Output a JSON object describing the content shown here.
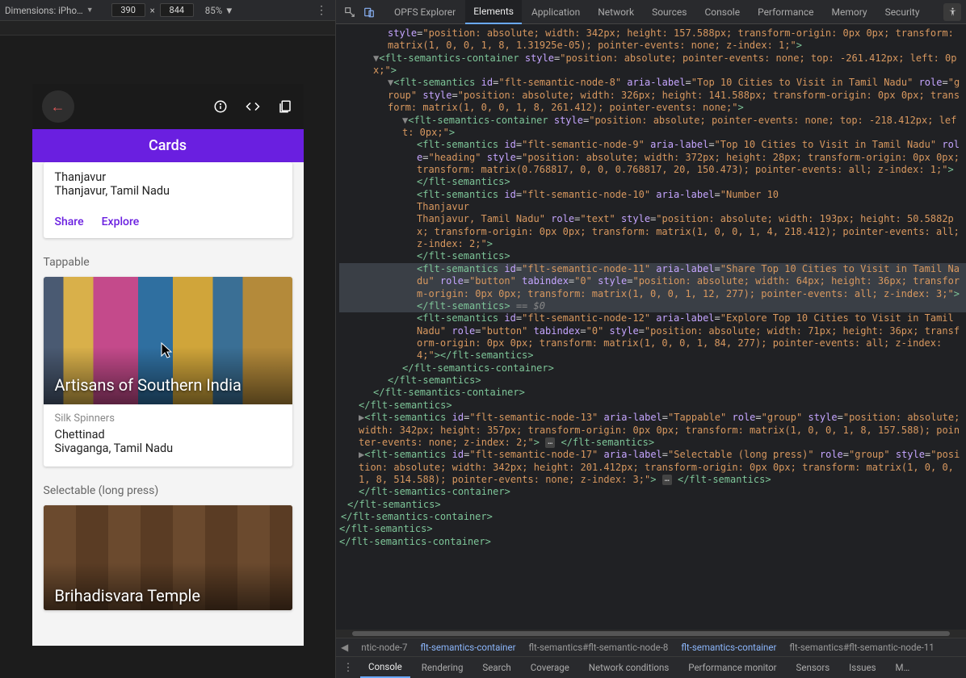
{
  "dev_toolbar": {
    "dimension_label": "Dimensions: iPho…",
    "width": "390",
    "height": "844",
    "zoom": "85%"
  },
  "phone": {
    "header": "Cards",
    "card1": {
      "title": "Thanjavur",
      "subtitle": "Thanjavur, Tamil Nadu",
      "action_share": "Share",
      "action_explore": "Explore"
    },
    "section_tappable": "Tappable",
    "card2": {
      "overlay": "Artisans of Southern India",
      "sub": "Silk Spinners",
      "title": "Chettinad",
      "subtitle": "Sivaganga, Tamil Nadu"
    },
    "section_selectable": "Selectable (long press)",
    "card3": {
      "overlay": "Brihadisvara Temple"
    }
  },
  "devtools_tabs": {
    "opfs": "OPFS Explorer",
    "elements": "Elements",
    "application": "Application",
    "network": "Network",
    "sources": "Sources",
    "console": "Console",
    "performance": "Performance",
    "memory": "Memory",
    "security": "Security"
  },
  "dom": {
    "n0_style": "position: absolute; width: 342px; height: 157.588px; transform-origin: 0px 0px; transform: matrix(1, 0, 0, 1, 8, 1.31925e-05); pointer-events: none; z-index: 1;",
    "n_cont_a_style": "position: absolute; pointer-events: none; top: -261.412px; left: 0px;",
    "n8_id": "flt-semantic-node-8",
    "n8_aria": "Top 10 Cities to Visit in Tamil Nadu",
    "n8_role": "group",
    "n8_style": "position: absolute; width: 326px; height: 141.588px; transform-origin: 0px 0px; transform: matrix(1, 0, 0, 1, 8, 261.412); pointer-events: none;",
    "n_cont_b_style": "position: absolute; pointer-events: none; top: -218.412px; left: 0px;",
    "n9_id": "flt-semantic-node-9",
    "n9_aria": "Top 10 Cities to Visit in Tamil Nadu",
    "n9_role": "heading",
    "n9_style": "position: absolute; width: 372px; height: 28px; transform-origin: 0px 0px; transform: matrix(0.768817, 0, 0, 0.768817, 20, 150.473); pointer-events: all; z-index: 1;",
    "n10_id": "flt-semantic-node-10",
    "n10_aria": "Number 10\nThanjavur\nThanjavur, Tamil Nadu",
    "n10_role": "text",
    "n10_style": "position: absolute; width: 193px; height: 50.5882px; transform-origin: 0px 0px; transform: matrix(1, 0, 0, 1, 4, 218.412); pointer-events: all; z-index: 2;",
    "n11_id": "flt-semantic-node-11",
    "n11_aria": "Share Top 10 Cities to Visit in Tamil Nadu",
    "n11_role": "button",
    "n11_tabindex": "0",
    "n11_style": "position: absolute; width: 64px; height: 36px; transform-origin: 0px 0px; transform: matrix(1, 0, 0, 1, 12, 277); pointer-events: all; z-index: 3;",
    "n12_id": "flt-semantic-node-12",
    "n12_aria": "Explore Top 10 Cities to Visit in Tamil Nadu",
    "n12_role": "button",
    "n12_tabindex": "0",
    "n12_style": "position: absolute; width: 71px; height: 36px; transform-origin: 0px 0px; transform: matrix(1, 0, 0, 1, 84, 277); pointer-events: all; z-index: 4;",
    "n13_id": "flt-semantic-node-13",
    "n13_aria": "Tappable",
    "n13_role": "group",
    "n13_style": "position: absolute; width: 342px; height: 357px; transform-origin: 0px 0px; transform: matrix(1, 0, 0, 1, 8, 157.588); pointer-events: none; z-index: 2;",
    "n17_id": "flt-semantic-node-17",
    "n17_aria": "Selectable (long press)",
    "n17_role": "group",
    "n17_style": "position: absolute; width: 342px; height: 201.412px; transform-origin: 0px 0px; transform: matrix(1, 0, 0, 1, 8, 514.588); pointer-events: none; z-index: 3;",
    "close_tag_container": "</flt-semantics-container>",
    "close_tag_semantics": "</flt-semantics>",
    "eq_sel": " == $0"
  },
  "breadcrumb": {
    "b0": "ntic-node-7",
    "b1": "flt-semantics-container",
    "b2": "flt-semantics#flt-semantic-node-8",
    "b3": "flt-semantics-container",
    "b4": "flt-semantics#flt-semantic-node-11"
  },
  "drawer": {
    "console": "Console",
    "rendering": "Rendering",
    "search": "Search",
    "coverage": "Coverage",
    "netcond": "Network conditions",
    "perfmon": "Performance monitor",
    "sensors": "Sensors",
    "issues": "Issues",
    "more": "M…"
  }
}
